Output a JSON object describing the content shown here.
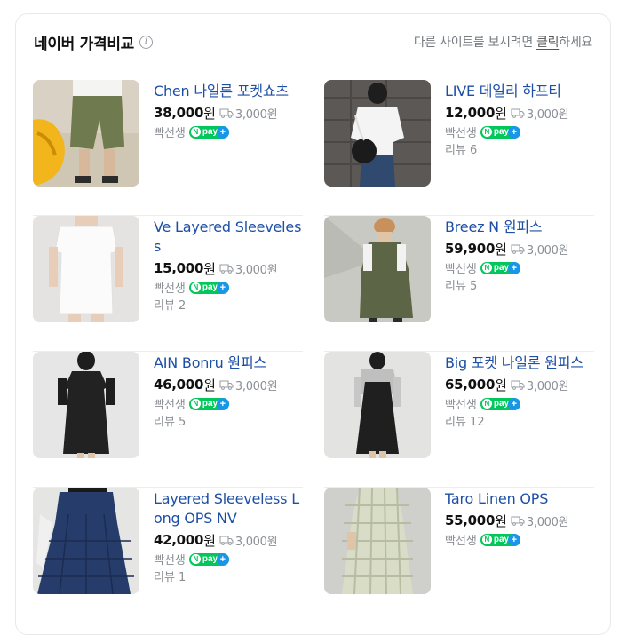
{
  "header": {
    "title": "네이버 가격비교",
    "info_icon": "info-icon",
    "hint_prefix": "다른 사이트를 보시려면 ",
    "hint_link": "클릭",
    "hint_suffix": "하세요"
  },
  "products": [
    {
      "name": "Chen 나일론 포켓쇼츠",
      "price": "38,000",
      "won": "원",
      "shipping": "3,000원",
      "seller": "빡선생",
      "review": "",
      "image": "shorts-kayak"
    },
    {
      "name": "LIVE 데일리 하프티",
      "price": "12,000",
      "won": "원",
      "shipping": "3,000원",
      "seller": "빡선생",
      "review": "리뷰 6",
      "image": "white-tee-bag"
    },
    {
      "name": "Ve Layered Sleeveless",
      "price": "15,000",
      "won": "원",
      "shipping": "3,000원",
      "seller": "빡선생",
      "review": "리뷰 2",
      "image": "white-sleeveless"
    },
    {
      "name": "Breez N 원피스",
      "price": "59,900",
      "won": "원",
      "shipping": "3,000원",
      "seller": "빡선생",
      "review": "리뷰 5",
      "image": "khaki-dress"
    },
    {
      "name": "AIN Bonru 원피스",
      "price": "46,000",
      "won": "원",
      "shipping": "3,000원",
      "seller": "빡선생",
      "review": "리뷰 5",
      "image": "black-dress"
    },
    {
      "name": "Big 포켓 나일론 원피스",
      "price": "65,000",
      "won": "원",
      "shipping": "3,000원",
      "seller": "빡선생",
      "review": "리뷰 12",
      "image": "black-pinafore"
    },
    {
      "name": "Layered Sleeveless Long OPS NV",
      "price": "42,000",
      "won": "원",
      "shipping": "3,000원",
      "seller": "빡선생",
      "review": "리뷰 1",
      "image": "navy-dress"
    },
    {
      "name": "Taro Linen OPS",
      "price": "55,000",
      "won": "원",
      "shipping": "3,000원",
      "seller": "빡선생",
      "review": "",
      "image": "check-linen-dress"
    }
  ],
  "npay": {
    "n": "N",
    "pay": "pay",
    "plus": "+"
  },
  "colors": {
    "link": "#1d4fa6",
    "npay_green": "#03c75a",
    "npay_blue": "#1a96e8"
  }
}
